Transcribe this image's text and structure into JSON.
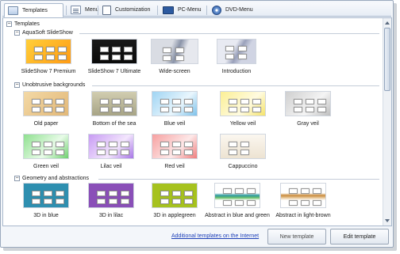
{
  "tabs": [
    {
      "label": "Templates",
      "icon": "templates-icon",
      "active": true
    },
    {
      "label": "Menu",
      "icon": "menu-icon"
    },
    {
      "label": "Customization",
      "icon": "customization-icon"
    },
    {
      "label": "PC-Menu",
      "icon": "pc-menu-icon"
    },
    {
      "label": "DVD-Menu",
      "icon": "dvd-icon"
    }
  ],
  "tree": {
    "root": "Templates",
    "sections": [
      {
        "title": "AquaSoft SlideShow",
        "items": [
          {
            "label": "SlideShow 7 Premium"
          },
          {
            "label": "SlideShow 7 Ultimate"
          },
          {
            "label": "Wide-screen"
          },
          {
            "label": "Introduction"
          }
        ]
      },
      {
        "title": "Unobtrusive backgrounds",
        "items": [
          {
            "label": "Old paper"
          },
          {
            "label": "Bottom of the sea"
          },
          {
            "label": "Blue veil"
          },
          {
            "label": "Yellow veil"
          },
          {
            "label": "Gray veil"
          },
          {
            "label": "Green veil"
          },
          {
            "label": "Lilac veil"
          },
          {
            "label": "Red veil"
          },
          {
            "label": "Cappuccino"
          }
        ]
      },
      {
        "title": "Geometry and abstractions",
        "items": [
          {
            "label": "3D in blue"
          },
          {
            "label": "3D in lilac"
          },
          {
            "label": "3D in applegreen"
          },
          {
            "label": "Abstract in blue and green"
          },
          {
            "label": "Abstract in light-brown"
          }
        ]
      }
    ]
  },
  "footer": {
    "link": "Additional templates on the Internet",
    "new_button": "New template",
    "edit_button": "Edit template"
  }
}
